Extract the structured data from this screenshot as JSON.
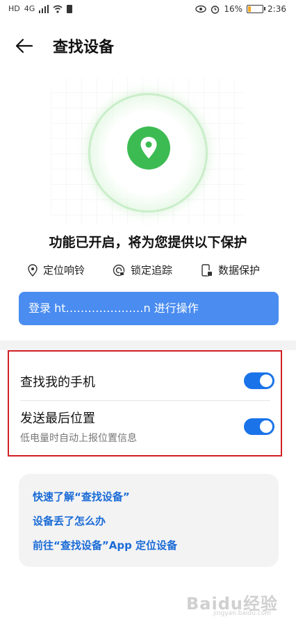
{
  "status_bar": {
    "left_icons": [
      "HD",
      "4G",
      "signal-icon",
      "wifi-icon",
      "sim-icon"
    ],
    "battery": "16%",
    "battery_level": 0.16,
    "time": "2:36"
  },
  "app_bar": {
    "title": "查找设备"
  },
  "headline": "功能已开启，将为您提供以下保护",
  "features": [
    {
      "icon": "location-pin-icon",
      "label": "定位响铃"
    },
    {
      "icon": "lock-track-icon",
      "label": "锁定追踪"
    },
    {
      "icon": "phone-data-icon",
      "label": "数据保护"
    }
  ],
  "login_button": {
    "label": "登录 ht…………………n 进行操作"
  },
  "settings": {
    "find_my_phone": {
      "label": "查找我的手机",
      "enabled": true
    },
    "send_last_location": {
      "label": "发送最后位置",
      "sub": "低电量时自动上报位置信息",
      "enabled": true
    }
  },
  "help": {
    "links": [
      "快速了解“查找设备”",
      "设备丢了怎么办",
      "前往“查找设备”App 定位设备"
    ]
  },
  "watermark": {
    "text": "Baidu经验",
    "sub": "jingyan.baidu.com"
  },
  "colors": {
    "accent": "#1a73e8",
    "button": "#4a8cf0",
    "green": "#3dbb53",
    "highlight_border": "#d11f25"
  }
}
